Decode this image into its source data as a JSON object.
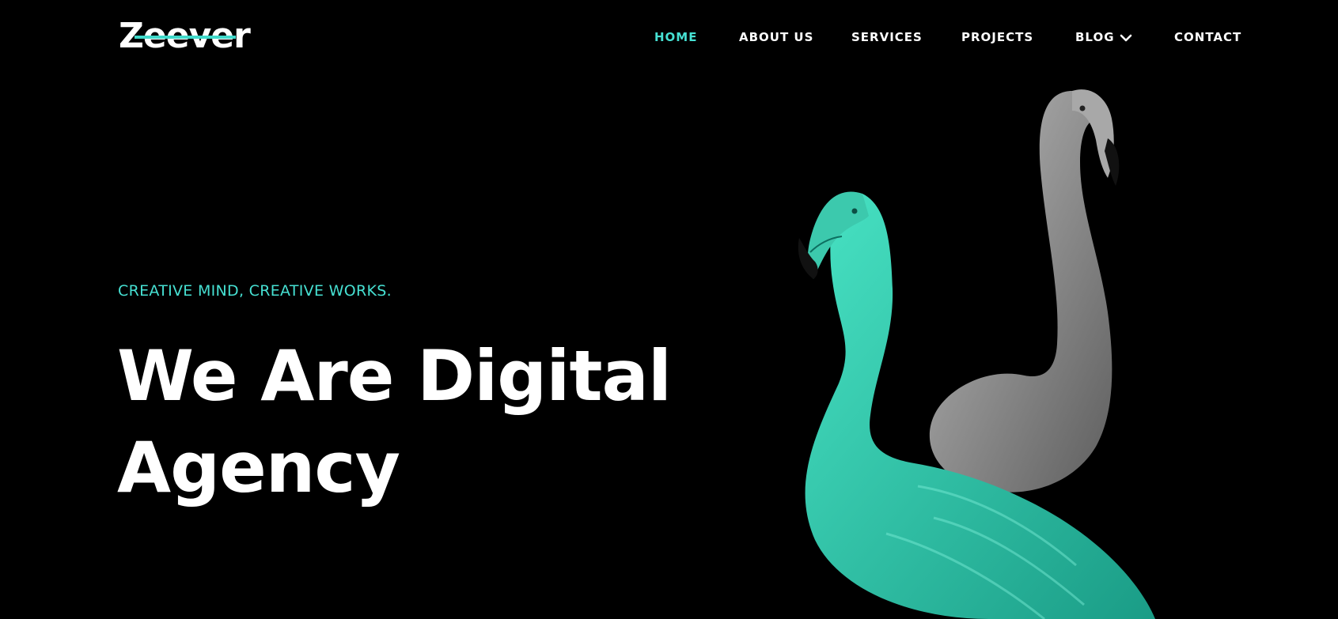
{
  "brand": {
    "name": "Zeever",
    "accent": "#46e0d2"
  },
  "nav": {
    "items": [
      {
        "label": "HOME",
        "active": true
      },
      {
        "label": "ABOUT US",
        "active": false
      },
      {
        "label": "SERVICES",
        "active": false
      },
      {
        "label": "PROJECTS",
        "active": false
      },
      {
        "label": "BLOG",
        "active": false,
        "dropdown": true,
        "icon": "chevron-down-icon"
      },
      {
        "label": "CONTACT",
        "active": false
      }
    ]
  },
  "hero": {
    "tagline": "CREATIVE MIND, CREATIVE WORKS.",
    "headline_line1": "We Are Digital",
    "headline_line2": "Agency",
    "image": {
      "subject": "flamingos",
      "front_color": "#2fd3b4",
      "back_color": "#8a8a8a"
    }
  }
}
